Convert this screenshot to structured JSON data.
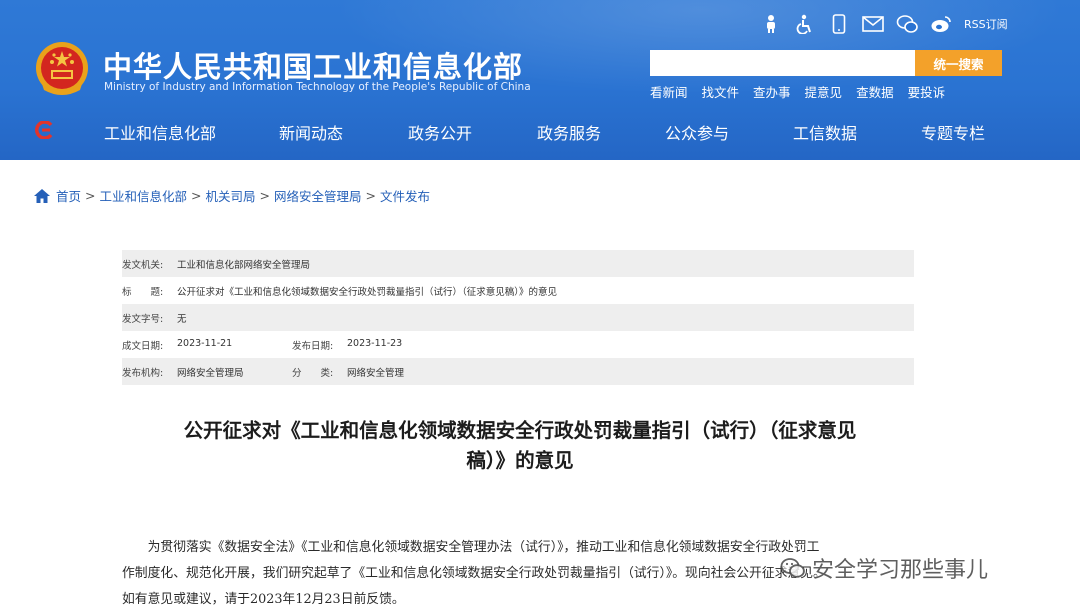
{
  "header": {
    "site_title": "中华人民共和国工业和信息化部",
    "site_subtitle": "Ministry of Industry and Information Technology of the People's Republic of China",
    "rss_label": "RSS订阅",
    "top_icons": [
      "elderly-mode-icon",
      "accessibility-icon",
      "mobile-icon",
      "mail-icon",
      "wechat-icon",
      "weibo-icon",
      "rss-icon"
    ],
    "search": {
      "placeholder": "",
      "button_label": "统一搜索"
    },
    "quick_links": [
      "看新闻",
      "找文件",
      "查办事",
      "提意见",
      "查数据",
      "要投诉"
    ],
    "nav": [
      "工业和信息化部",
      "新闻动态",
      "政务公开",
      "政务服务",
      "公众参与",
      "工信数据",
      "专题专栏"
    ]
  },
  "breadcrumb": [
    "首页",
    "工业和信息化部",
    "机关司局",
    "网络安全管理局",
    "文件发布"
  ],
  "meta": {
    "issuer_label": "发文机关:",
    "issuer": "工业和信息化部网络安全管理局",
    "title_label": "标　　题:",
    "title": "公开征求对《工业和信息化领域数据安全行政处罚裁量指引（试行）（征求意见稿）》的意见",
    "doc_no_label": "发文字号:",
    "doc_no": "无",
    "created_label": "成文日期:",
    "created": "2023-11-21",
    "published_label": "发布日期:",
    "published": "2023-11-23",
    "org_label": "发布机构:",
    "org": "网络安全管理局",
    "category_label": "分　　类:",
    "category": "网络安全管理"
  },
  "article": {
    "title_line1": "公开征求对《工业和信息化领域数据安全行政处罚裁量指引（试行）（征求意见",
    "title_line2": "稿）》的意见",
    "body_line1": "为贯彻落实《数据安全法》《工业和信息化领域数据安全管理办法（试行）》，推动工业和信息化领域数据安全行政处罚工",
    "body_line2": "作制度化、规范化开展，我们研究起草了《工业和信息化领域数据安全行政处罚裁量指引（试行）》。现向社会公开征求意见。",
    "body_line3": "如有意见或建议，请于2023年12月23日前反馈。"
  },
  "watermark": {
    "text": "安全学习那些事儿"
  },
  "colors": {
    "header_blue": "#2a73d2",
    "search_button": "#f3a12a",
    "link_blue": "#2560b8"
  }
}
